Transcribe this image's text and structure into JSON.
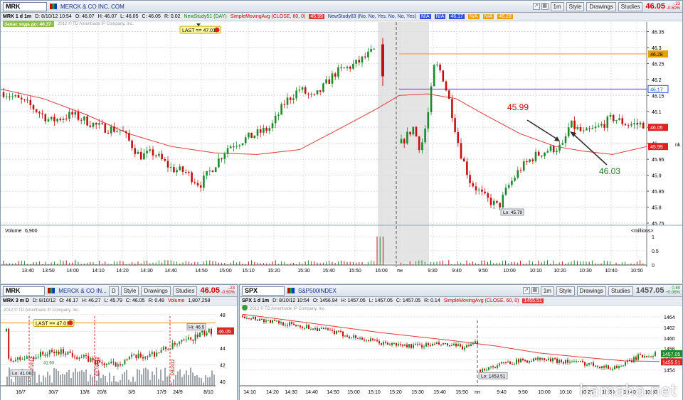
{
  "main": {
    "symbol": "MRK",
    "description": "MERCK & CO INC. COM",
    "period_button": "1m",
    "style_btn": "Style",
    "drawings_btn": "Drawings",
    "studies_btn": "Studies",
    "last_price": "46.05",
    "change_top": "-.23",
    "change_pct": "-0.50%",
    "info": {
      "label": "MRK 1 d 1m",
      "date": "D: 8/10/12 10:54",
      "open": "O: 46.07",
      "high": "H: 46.07",
      "low": "L: 46.05",
      "close": "C: 46.05",
      "range": "R: 0.02",
      "study1": "NewStudy51 (DAY)",
      "sma_label": "SimpleMovingAvg (CLOSE, 60, 0)",
      "sma_val": "45.99",
      "study2": "NewStudy83 (No, No, Yes, No, No, Yes)",
      "na1": "N/A",
      "na2": "N/A",
      "val_4617": "46.17",
      "na3": "N/A",
      "na4": "N/A",
      "val_4628": "46.28"
    },
    "ext_label": "Запас хода до: 46.37",
    "copyright": "2012 © TD Ameritrade IP Company, Inc.",
    "last_tag": "LAST == 47.01",
    "ann_high": "45.99",
    "ann_low": "46.03",
    "low_tag": "Lo: 45.79",
    "price_axis": [
      "46.35",
      "46.3",
      "46.25",
      "46.2",
      "46.15",
      "46.1",
      "46.05",
      "46",
      "45.95",
      "45.9",
      "45.85",
      "45.8",
      "45.75"
    ],
    "price_tags": {
      "orange": "46.28",
      "blue": "46.17",
      "last": "46.05",
      "sma": "45.99"
    },
    "volume_label": "Volume",
    "volume_value": "6,900",
    "millions": "<millions>",
    "vol_axis": [
      "1",
      "0.5",
      "0"
    ],
    "time_axis": [
      "13:40",
      "13:50",
      "14:00",
      "14:10",
      "14:20",
      "14:30",
      "14:40",
      "14:50",
      "15:00",
      "15:10",
      "15:20",
      "15:30",
      "15:40",
      "15:50",
      "16:00",
      "пн",
      "9:30",
      "9:40",
      "9:50",
      "10:00",
      "10:10",
      "10:20",
      "10:30",
      "10:40",
      "10:50"
    ],
    "edge_text": "nk"
  },
  "bl": {
    "symbol": "MRK",
    "description": "MERCK & CO IN...",
    "period_btn": "D",
    "style_btn": "Style",
    "drawings_btn": "Drawings",
    "studies_btn": "Studies",
    "last_price": "46.05",
    "change_top": "-.23",
    "change_pct": "-0.50%",
    "info": {
      "label": "MRK 3 m D",
      "date": "D: 8/10/12",
      "open": "O: 46.17",
      "high": "H: 46.27",
      "low": "L: 45.79",
      "close": "C: 46.05",
      "range": "R: 0.48",
      "volume": "Volume",
      "vol_val": "1,807,258"
    },
    "copyright": "2012 © TD Ameritrade IP Company, Inc.",
    "last_tag": "LAST == 47.01",
    "hi_tag": "Hi: 46.5",
    "lo_tag": "Lo: 41.06",
    "mark_4160": "41.60",
    "price_tag": "46.05",
    "axis": [
      "48",
      "46",
      "44",
      "42",
      "40"
    ],
    "dates": [
      "16/7",
      "30/7",
      "13/8",
      "20/8",
      "3/9",
      "17/9",
      "24/9",
      "8/10"
    ],
    "vlabels": [
      "12/7/2012",
      "8/17/2012",
      "3/8/2012"
    ]
  },
  "br": {
    "symbol": "SPX",
    "description": "S&P500INDEX",
    "period_button": "1m",
    "style_btn": "Style",
    "drawings_btn": "Drawings",
    "studies_btn": "Studies",
    "last_price": "1457.05",
    "change_top": "0.89",
    "change_pct": "+0.06%",
    "info": {
      "label": "SPX 1 d 1m",
      "date": "D: 8/10/12 10:54",
      "open": "O: 1456.94",
      "high": "H: 1457.05",
      "low": "L: 1457.05",
      "close": "C: 1457.05",
      "range": "R: 0.14",
      "sma_label": "SimpleMovingAvg (CLOSE, 60, 0)",
      "sma_val": "1455.51"
    },
    "copyright": "2012 © TD Ameritrade IP Company, Inc.",
    "lo_tag": "Lo: 1453.51",
    "axis": [
      "1464",
      "1462",
      "1460",
      "1458",
      "1456",
      "1454"
    ],
    "tags": {
      "last": "1457.05",
      "sma": "1455.51"
    },
    "times": [
      "14:10",
      "14:20",
      "14:30",
      "14:40",
      "14:50",
      "15:00",
      "15:10",
      "15:20",
      "15:30",
      "15:40",
      "15:50",
      "пн",
      "9:40",
      "9:50",
      "10:00",
      "10:10",
      "10:20",
      "10:30",
      "10:40",
      "10:50"
    ]
  },
  "watermark": "hamaha.net",
  "colors": {
    "up": "#1d8a2a",
    "down": "#c41010",
    "sma": "#e03a3a",
    "orange": "#e8a000",
    "blue": "#2f4fd8"
  }
}
